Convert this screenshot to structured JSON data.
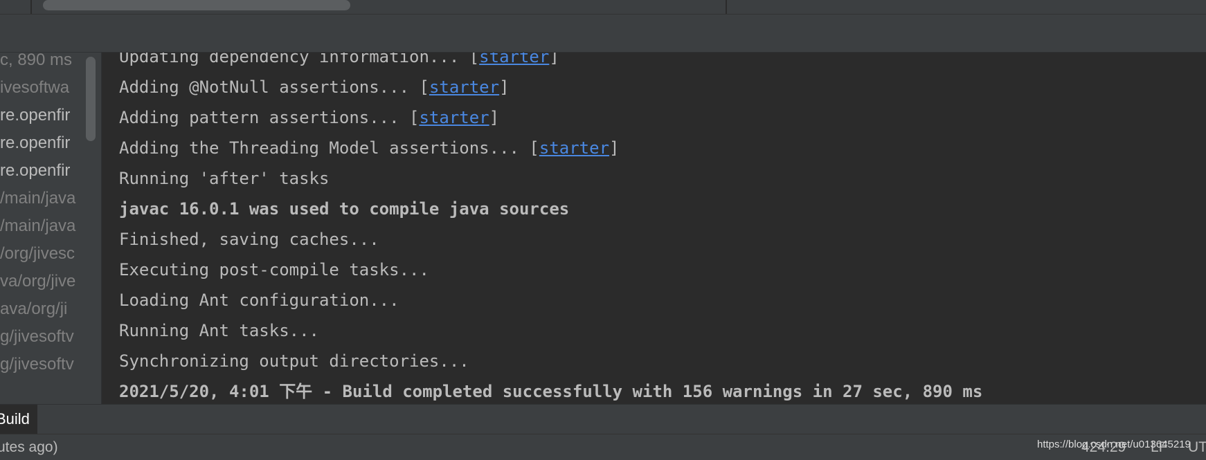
{
  "tree": {
    "items": [
      {
        "label": "c, 890 ms",
        "bright": false
      },
      {
        "label": "ivesoftwa",
        "bright": false
      },
      {
        "label": "re.openfir",
        "bright": true
      },
      {
        "label": "re.openfir",
        "bright": true
      },
      {
        "label": "re.openfir",
        "bright": true
      },
      {
        "label": "/main/java",
        "bright": false
      },
      {
        "label": "/main/java",
        "bright": false
      },
      {
        "label": "/org/jivesc",
        "bright": false
      },
      {
        "label": "va/org/jive",
        "bright": false
      },
      {
        "label": "ava/org/ji",
        "bright": false
      },
      {
        "label": "g/jivesoftv",
        "bright": false
      },
      {
        "label": "g/jivesoftv",
        "bright": false
      }
    ]
  },
  "console": {
    "lines": [
      {
        "pre": "Updating dependency information... [",
        "link": "starter",
        "post": "]",
        "bold": false
      },
      {
        "pre": "Adding @NotNull assertions... [",
        "link": "starter",
        "post": "]",
        "bold": false
      },
      {
        "pre": "Adding pattern assertions... [",
        "link": "starter",
        "post": "]",
        "bold": false
      },
      {
        "pre": "Adding the Threading Model assertions... [",
        "link": "starter",
        "post": "]",
        "bold": false
      },
      {
        "pre": "Running 'after' tasks",
        "link": "",
        "post": "",
        "bold": false
      },
      {
        "pre": "javac 16.0.1 was used to compile java sources",
        "link": "",
        "post": "",
        "bold": true
      },
      {
        "pre": "Finished, saving caches...",
        "link": "",
        "post": "",
        "bold": false
      },
      {
        "pre": "Executing post-compile tasks...",
        "link": "",
        "post": "",
        "bold": false
      },
      {
        "pre": "Loading Ant configuration...",
        "link": "",
        "post": "",
        "bold": false
      },
      {
        "pre": "Running Ant tasks...",
        "link": "",
        "post": "",
        "bold": false
      },
      {
        "pre": "Synchronizing output directories...",
        "link": "",
        "post": "",
        "bold": false
      },
      {
        "pre": "2021/5/20, 4:01 下午 - Build completed successfully with 156 warnings in 27 sec, 890 ms",
        "link": "",
        "post": "",
        "bold": true
      }
    ]
  },
  "tabs": {
    "build_label": "Build"
  },
  "status": {
    "left_text": "utes ago)",
    "position": "424:29",
    "line_sep": "LF",
    "encoding": "UT",
    "watermark": "https://blog.csdn.net/u013645219"
  },
  "colors": {
    "link": "#4a88e2",
    "text": "#bbbbbb",
    "background": "#2b2b2b",
    "panel": "#3c3f41"
  }
}
